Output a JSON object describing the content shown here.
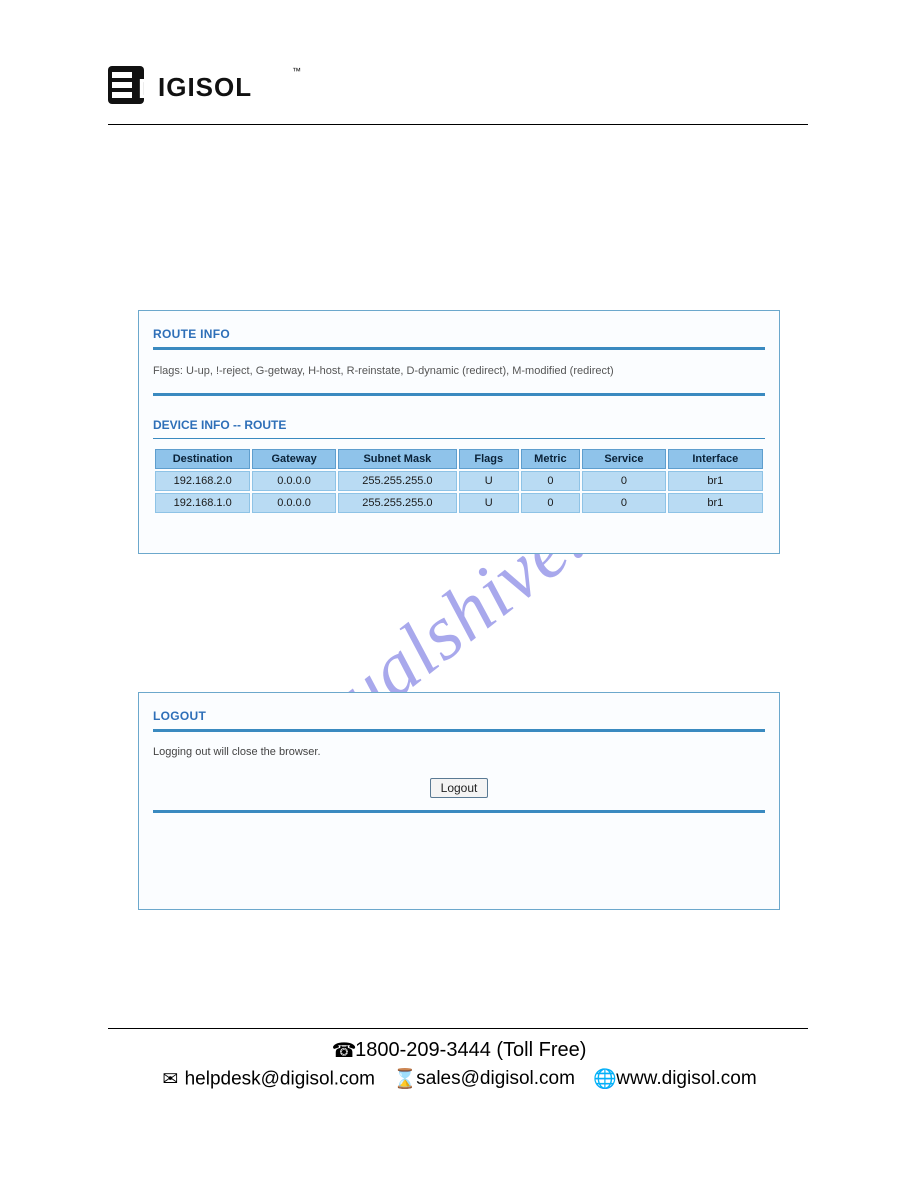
{
  "logo": {
    "text": "DIGISOL"
  },
  "watermark": "manualshive.com",
  "routePanel": {
    "title": "ROUTE INFO",
    "flagsText": "Flags: U-up, !-reject, G-getway, H-host, R-reinstate, D-dynamic (redirect), M-modified (redirect)",
    "subTitle": "DEVICE INFO -- ROUTE",
    "headers": [
      "Destination",
      "Gateway",
      "Subnet Mask",
      "Flags",
      "Metric",
      "Service",
      "Interface"
    ],
    "rows": [
      {
        "c0": "192.168.2.0",
        "c1": "0.0.0.0",
        "c2": "255.255.255.0",
        "c3": "U",
        "c4": "0",
        "c5": "0",
        "c6": "br1"
      },
      {
        "c0": "192.168.1.0",
        "c1": "0.0.0.0",
        "c2": "255.255.255.0",
        "c3": "U",
        "c4": "0",
        "c5": "0",
        "c6": "br1"
      }
    ]
  },
  "logoutPanel": {
    "title": "LOGOUT",
    "text": "Logging out will close the browser.",
    "buttonLabel": "Logout"
  },
  "footer": {
    "phone": "1800-209-3444 (Toll Free)",
    "helpdesk": "helpdesk@digisol.com",
    "sales": "sales@digisol.com",
    "web": "www.digisol.com"
  }
}
